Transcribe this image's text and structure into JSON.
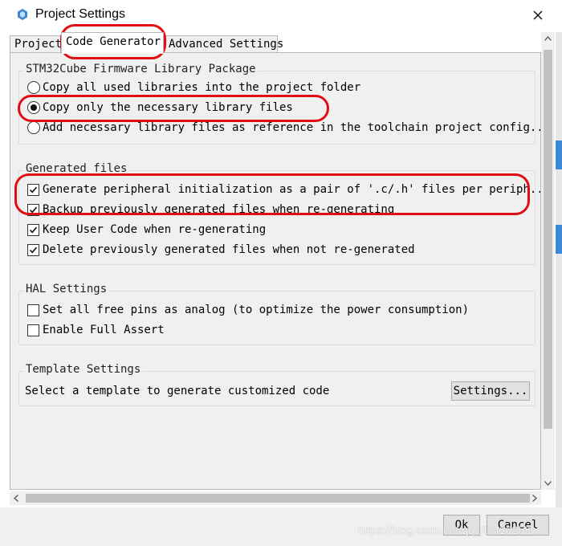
{
  "window": {
    "title": "Project Settings"
  },
  "tabs": [
    {
      "label": "Project"
    },
    {
      "label": "Code Generator"
    },
    {
      "label": "Advanced Settings"
    }
  ],
  "firmware_group": {
    "title": "STM32Cube Firmware Library Package",
    "options": [
      {
        "label": "Copy all used libraries into the project folder",
        "selected": false
      },
      {
        "label": "Copy only the necessary library files",
        "selected": true
      },
      {
        "label": "Add necessary library files as reference in the toolchain project config...",
        "selected": false
      }
    ]
  },
  "generated_group": {
    "title": "Generated files",
    "options": [
      {
        "label": "Generate peripheral initialization as a pair of '.c/.h' files per periph...",
        "checked": true
      },
      {
        "label": "Backup previously generated files when re-generating",
        "checked": true
      },
      {
        "label": "Keep User Code when re-generating",
        "checked": true
      },
      {
        "label": "Delete previously generated files when not re-generated",
        "checked": true
      }
    ]
  },
  "hal_group": {
    "title": "HAL Settings",
    "options": [
      {
        "label": "Set all free pins as analog (to optimize the power consumption)",
        "checked": false
      },
      {
        "label": "Enable Full Assert",
        "checked": false
      }
    ]
  },
  "template_group": {
    "title": "Template Settings",
    "description": "Select a template to generate customized code",
    "button": "Settings..."
  },
  "footer": {
    "ok": "Ok",
    "cancel": "Cancel"
  },
  "watermark": "https://blog.csdn.net/qq_37416258",
  "colors": {
    "annotation": "#e00d13",
    "accent": "#3a8ad9"
  }
}
